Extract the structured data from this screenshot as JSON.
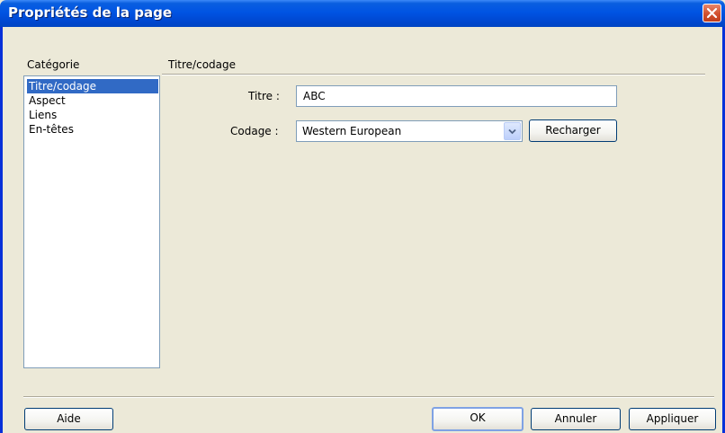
{
  "window": {
    "title": "Propriétés de la page"
  },
  "sidebar": {
    "heading": "Catégorie",
    "items": [
      {
        "label": "Titre/codage",
        "selected": true
      },
      {
        "label": "Aspect",
        "selected": false
      },
      {
        "label": "Liens",
        "selected": false
      },
      {
        "label": "En-têtes",
        "selected": false
      }
    ]
  },
  "panel": {
    "heading": "Titre/codage",
    "title_label": "Titre :",
    "title_value": "ABC",
    "encoding_label": "Codage :",
    "encoding_value": "Western European",
    "reload_label": "Recharger"
  },
  "footer": {
    "help_label": "Aide",
    "ok_label": "OK",
    "cancel_label": "Annuler",
    "apply_label": "Appliquer"
  },
  "colors": {
    "titlebar": "#0054e3",
    "selection": "#316ac5",
    "dialog_bg": "#ece9d8",
    "close": "#d2502e"
  },
  "icons": {
    "close": "close-icon",
    "dropdown": "chevron-down-icon"
  }
}
